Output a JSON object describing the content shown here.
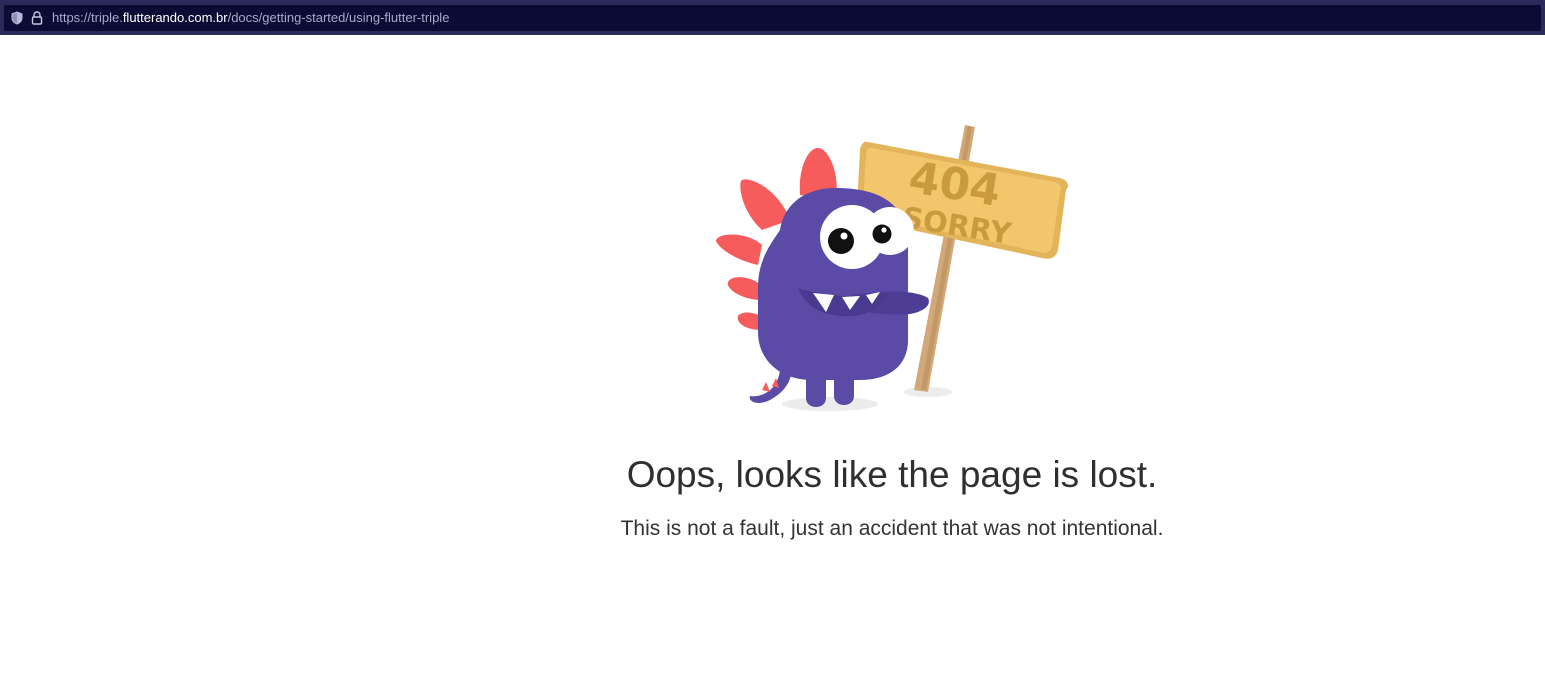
{
  "browser": {
    "url_scheme": "https://triple.",
    "url_host": "flutterando.com.br",
    "url_path": "/docs/getting-started/using-flutter-triple",
    "icons": [
      "shield-icon",
      "lock-icon"
    ]
  },
  "error_page": {
    "sign_code": "404",
    "sign_text": "SORRY",
    "headline": "Oops, looks like the page is lost.",
    "message": "This is not a fault, just an accident that was not intentional.",
    "colors": {
      "monster": "#5b4ba6",
      "spikes": "#f75c5c",
      "sign": "#f0c46a",
      "sign_text": "#c99a3e",
      "post": "#d2a878"
    }
  }
}
